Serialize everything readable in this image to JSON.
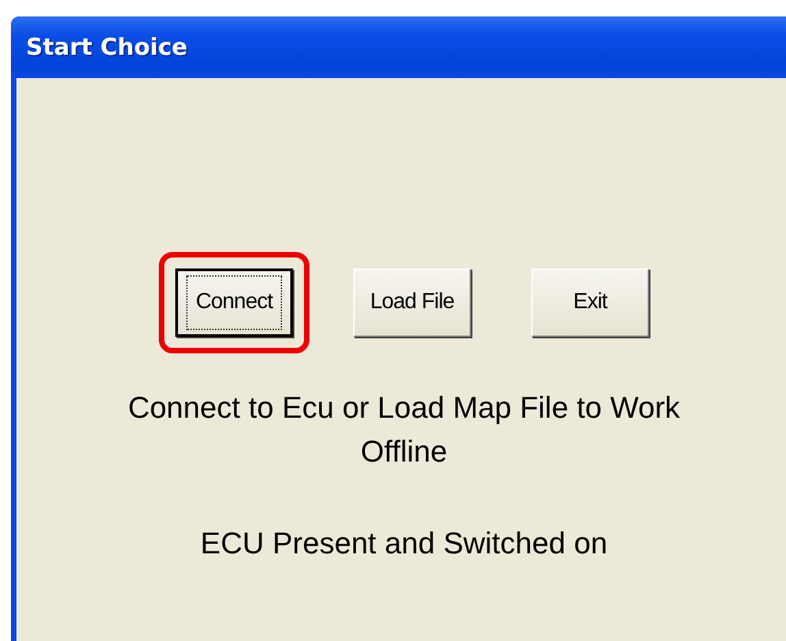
{
  "window": {
    "title": "Start Choice"
  },
  "buttons": [
    {
      "label": "Connect",
      "focused": true,
      "highlighted": true
    },
    {
      "label": "Load File",
      "focused": false,
      "highlighted": false
    },
    {
      "label": "Exit",
      "focused": false,
      "highlighted": false
    }
  ],
  "message": "Connect to Ecu or Load Map File to Work Offline",
  "status": "ECU Present and Switched on"
}
